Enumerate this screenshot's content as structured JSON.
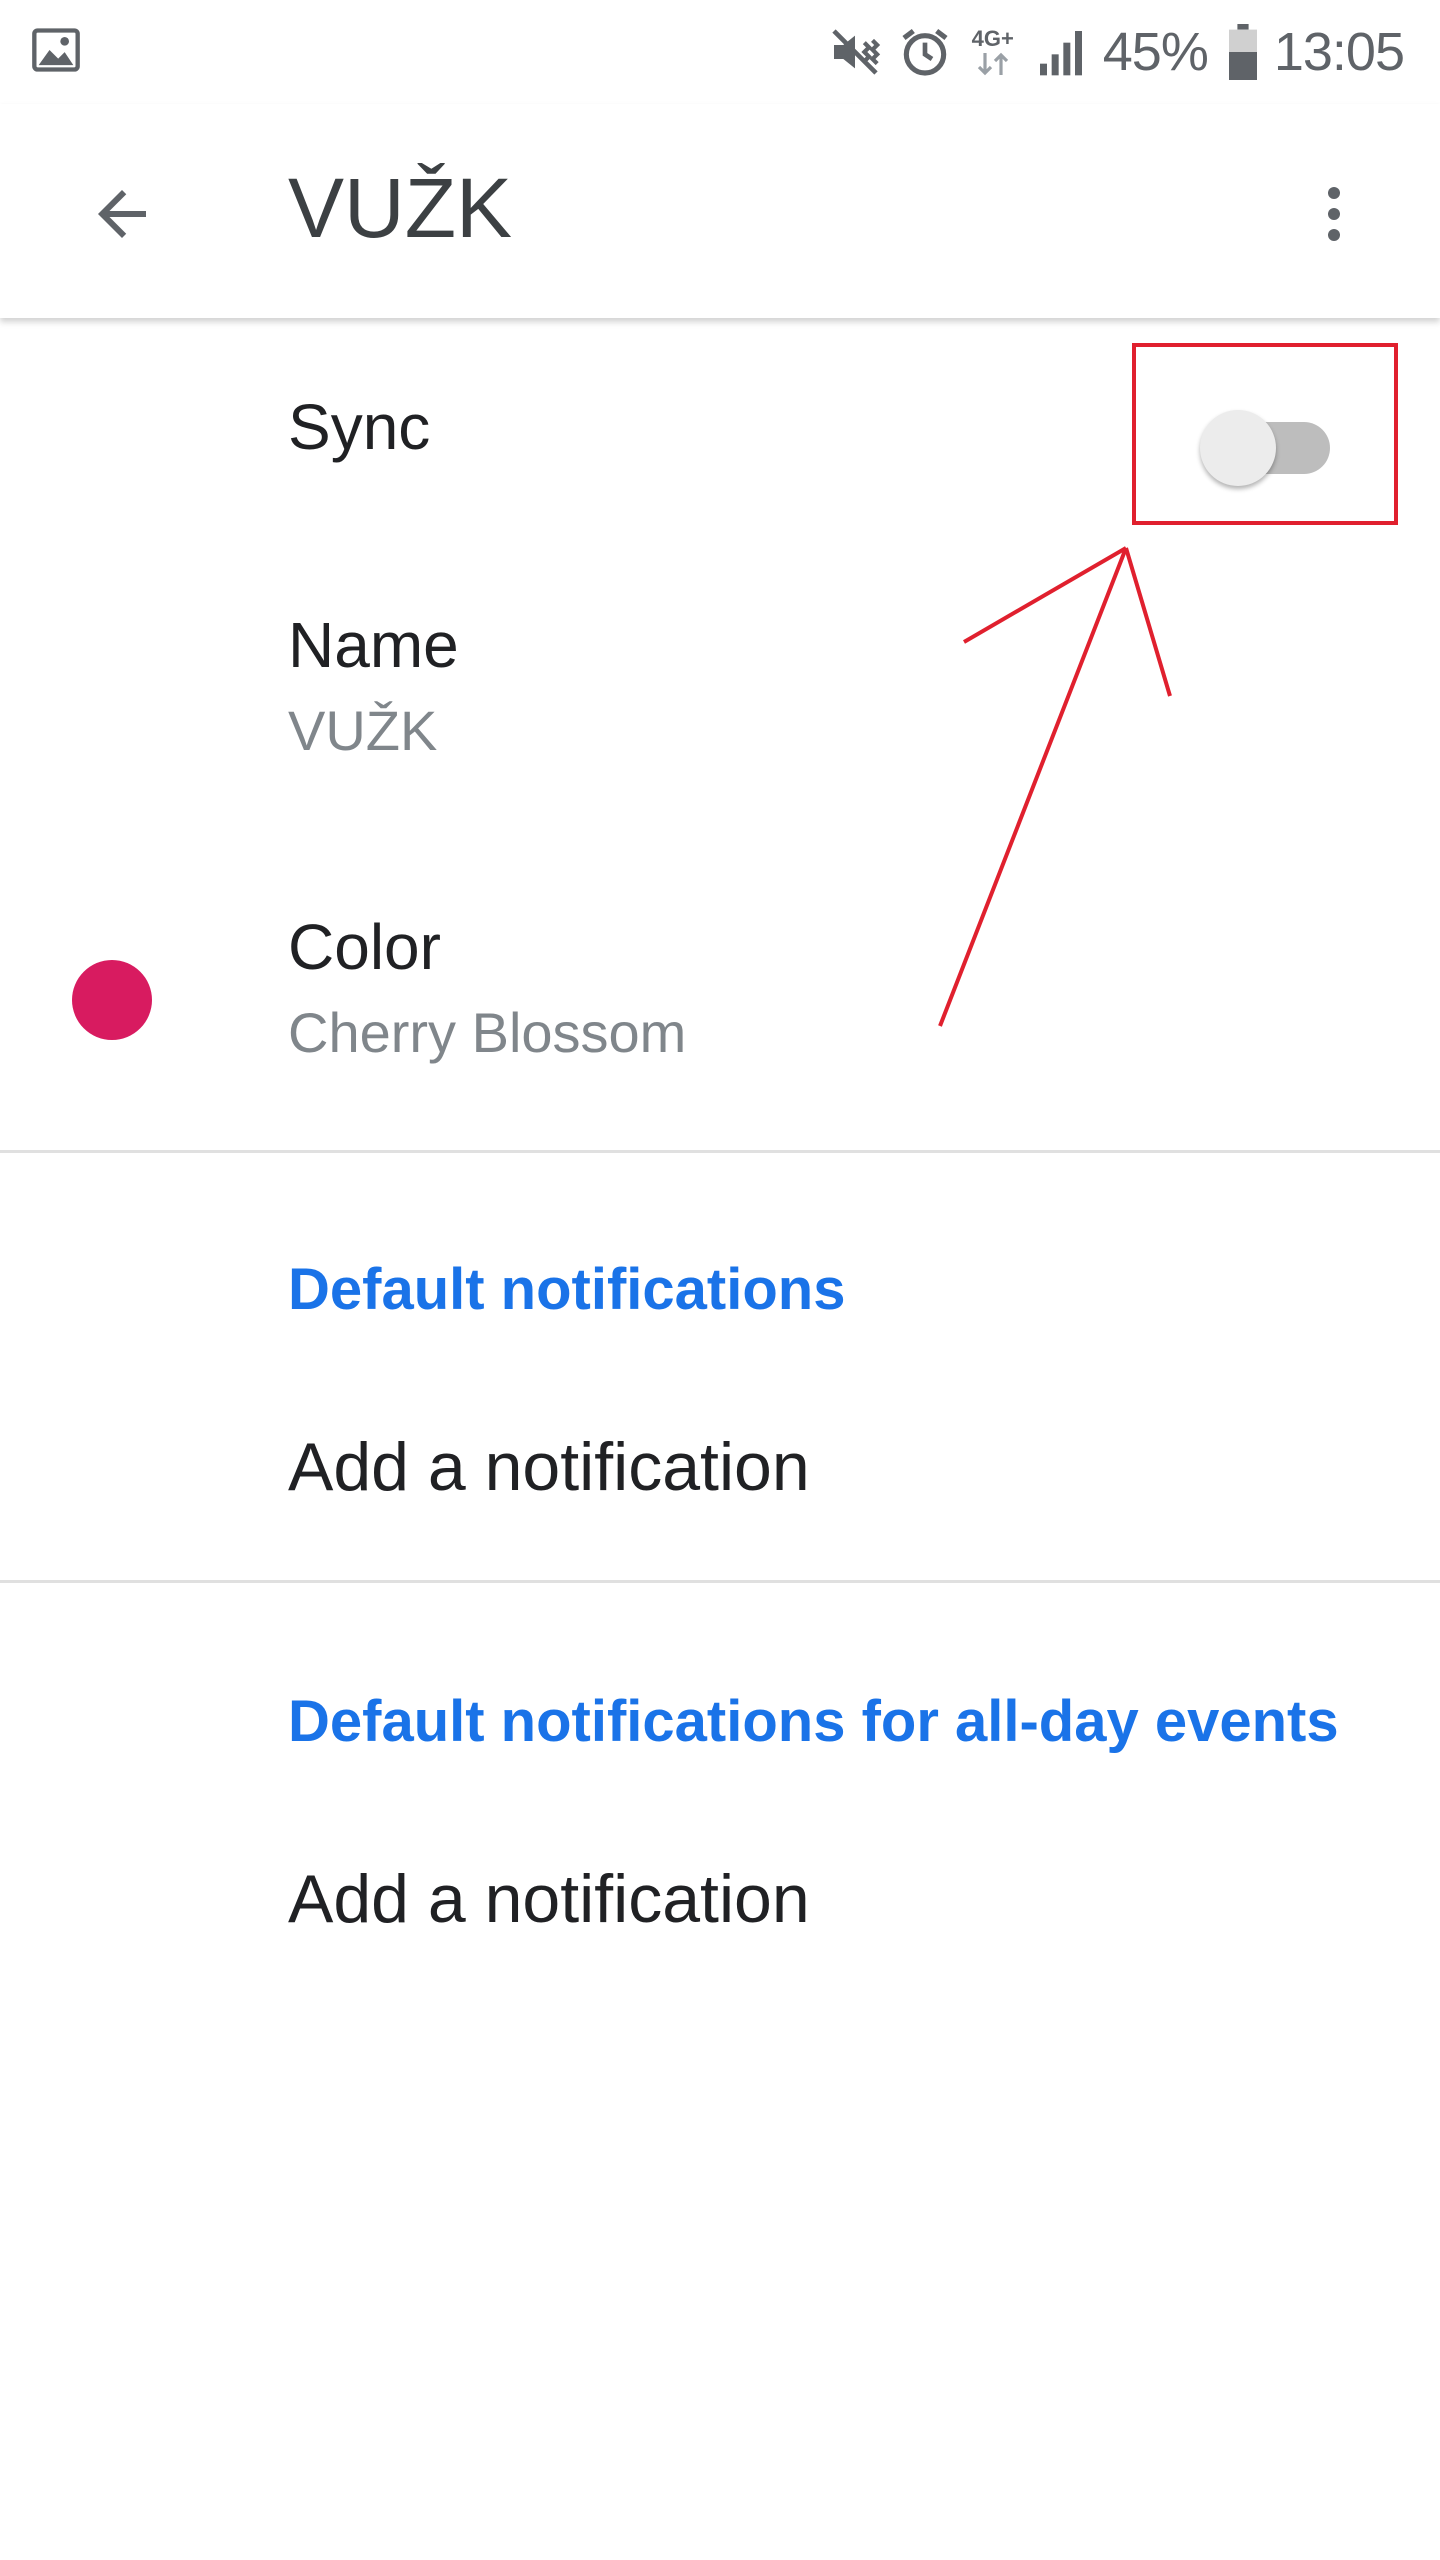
{
  "status_bar": {
    "left_icon": "image-icon",
    "network_label": "4G+",
    "battery_percent": "45%",
    "time": "13:05"
  },
  "app_bar": {
    "title": "VUŽK",
    "back_icon": "arrow-back-icon",
    "more_icon": "more-vert-icon"
  },
  "settings": {
    "sync": {
      "label": "Sync",
      "enabled": false
    },
    "name": {
      "label": "Name",
      "value": "VUŽK"
    },
    "color": {
      "label": "Color",
      "value": "Cherry Blossom",
      "swatch": "#d81b60"
    }
  },
  "notifications": {
    "header": "Default notifications",
    "add_label": "Add a notification"
  },
  "all_day_notifications": {
    "header": "Default notifications for all-day events",
    "add_label": "Add a notification"
  },
  "colors": {
    "accent": "#1a73e8",
    "annotation": "#e0202e"
  }
}
